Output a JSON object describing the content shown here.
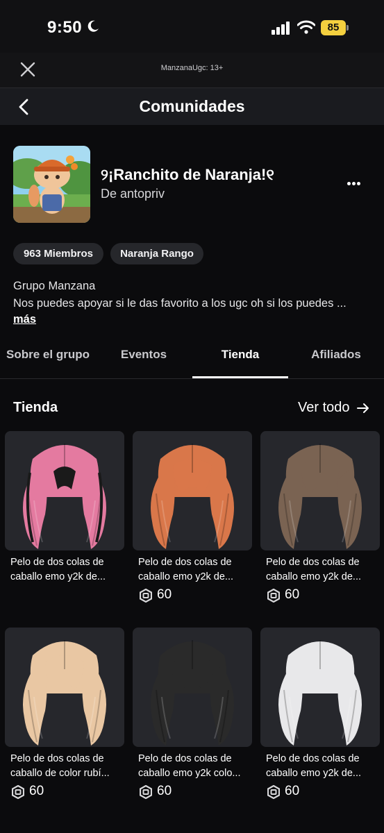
{
  "status_bar": {
    "time": "9:50",
    "battery": "85"
  },
  "top_bar": {
    "host": "ManzanaUgc: 13+"
  },
  "nav": {
    "title": "Comunidades"
  },
  "group": {
    "name": "୨¡Ranchito de Naranja!୧",
    "owner": "De antopriv",
    "members": "963 Miembros",
    "rank": "Naranja Rango",
    "desc_title": "Grupo Manzana",
    "desc_text": "Nos puedes apoyar si le das favorito a los ugc oh si los puedes ...",
    "more": "más"
  },
  "tabs": [
    "Sobre el grupo",
    "Eventos",
    "Tienda",
    "Afiliados"
  ],
  "active_tab": "Tienda",
  "store": {
    "title": "Tienda",
    "see_all": "Ver todo",
    "items": [
      {
        "name_line1": "Pelo de dos colas de",
        "name_line2": "caballo emo y2k de...",
        "price": "",
        "hair_color": "#e47aa0",
        "accent": "#1a1a1a"
      },
      {
        "name_line1": "Pelo de dos colas de",
        "name_line2": "caballo emo y2k de...",
        "price": "60",
        "hair_color": "#d9774a",
        "accent": ""
      },
      {
        "name_line1": "Pelo de dos colas de",
        "name_line2": "caballo emo y2k de...",
        "price": "60",
        "hair_color": "#7a6352",
        "accent": ""
      },
      {
        "name_line1": "Pelo de dos colas de",
        "name_line2": "caballo de color rubí...",
        "price": "60",
        "hair_color": "#e9c7a3",
        "accent": ""
      },
      {
        "name_line1": "Pelo de dos colas de",
        "name_line2": "caballo emo y2k colo...",
        "price": "60",
        "hair_color": "#2a2a2a",
        "accent": ""
      },
      {
        "name_line1": "Pelo de dos colas de",
        "name_line2": "caballo emo y2k de...",
        "price": "60",
        "hair_color": "#e8e8ea",
        "accent": ""
      }
    ]
  },
  "colors": {
    "background": "#0b0b0d",
    "chip": "#26272b",
    "card": "#26272c",
    "battery": "#f4d03f"
  }
}
